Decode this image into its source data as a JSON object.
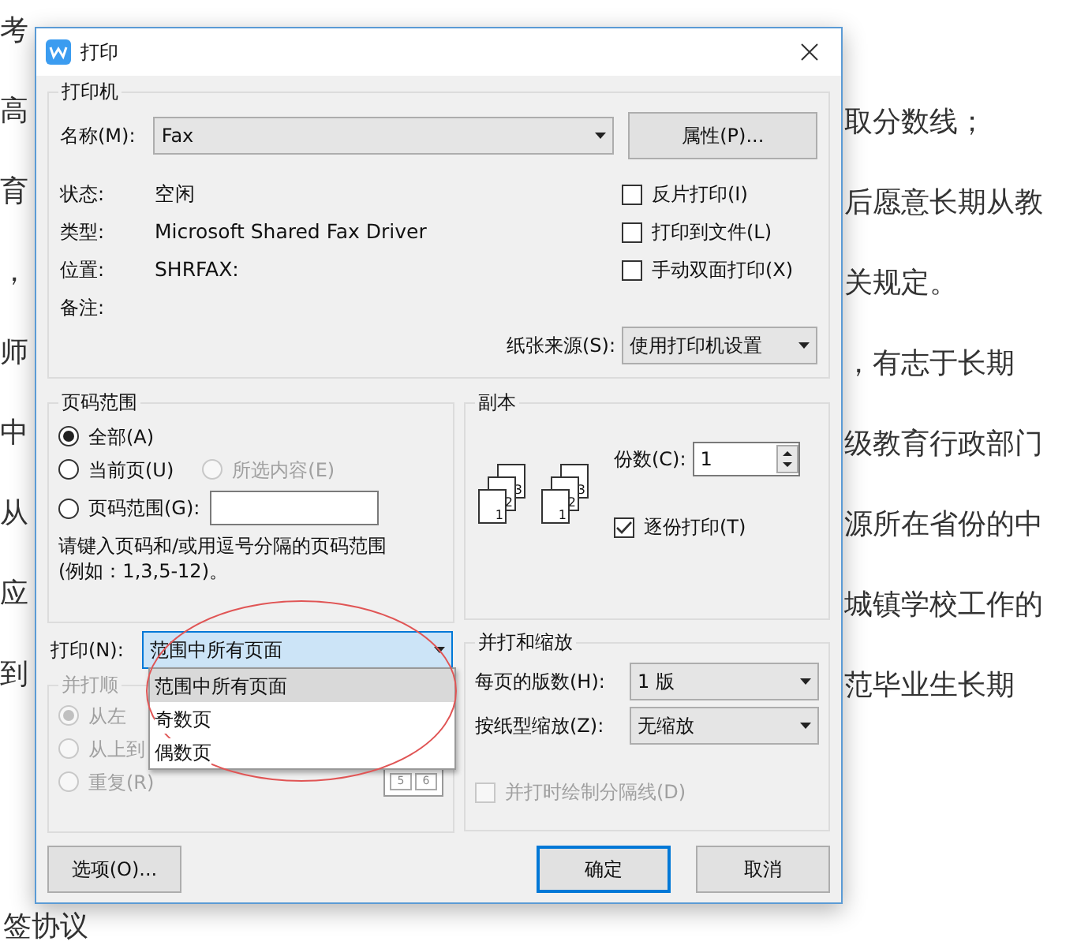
{
  "document": {
    "left_lines": [
      "考",
      "高",
      "育",
      "，",
      "师",
      "中",
      "从",
      "应",
      "到"
    ],
    "right_lines": [
      "取分数线；",
      "后愿意长期从教",
      "关规定。",
      "，有志于长期",
      "级教育行政部门",
      "源所在省份的中",
      "城镇学校工作的",
      "范毕业生长期"
    ],
    "bottom_line": "签协议"
  },
  "dialog": {
    "title": "打印",
    "printer": {
      "legend": "打印机",
      "name_label": "名称(M):",
      "name_value": "Fax",
      "properties_button": "属性(P)...",
      "info": [
        {
          "label": "状态:",
          "value": "空闲"
        },
        {
          "label": "类型:",
          "value": "Microsoft Shared Fax Driver"
        },
        {
          "label": "位置:",
          "value": "SHRFAX:"
        },
        {
          "label": "备注:"
        }
      ],
      "options": [
        {
          "label": "反片打印(I)",
          "checked": false
        },
        {
          "label": "打印到文件(L)",
          "checked": false
        },
        {
          "label": "手动双面打印(X)",
          "checked": false
        }
      ],
      "paper_source_label": "纸张来源(S):",
      "paper_source_value": "使用打印机设置"
    },
    "page_range": {
      "legend": "页码范围",
      "options": [
        {
          "label": "全部(A)",
          "selected": true,
          "disabled": false
        },
        {
          "label": "当前页(U)",
          "selected": false,
          "disabled": false
        },
        {
          "label": "所选内容(E)",
          "selected": false,
          "disabled": true
        },
        {
          "label": "页码范围(G):",
          "selected": false,
          "disabled": false
        }
      ],
      "hint_lines": [
        "请键入页码和/或用逗号分隔的页码范围",
        "(例如：1,3,5-12)。"
      ]
    },
    "copies": {
      "legend": "副本",
      "count_label": "份数(C):",
      "count_value": "1",
      "page_stacks": [
        [
          "1",
          "2",
          "3"
        ],
        [
          "1",
          "2",
          "3"
        ]
      ],
      "collate": {
        "label": "逐份打印(T)",
        "checked": true
      }
    },
    "print_what": {
      "label": "打印(N):",
      "value": "范围中所有页面",
      "menu": [
        {
          "label": "范围中所有页面",
          "selected": true
        },
        {
          "label": "奇数页",
          "selected": false
        },
        {
          "label": "偶数页",
          "selected": false
        }
      ]
    },
    "merge_order": {
      "legend": "并打顺",
      "disabled": true,
      "options": [
        {
          "label": "从左",
          "selected": true
        },
        {
          "label": "从上到",
          "selected": false
        },
        {
          "label": "重复(R)",
          "selected": false
        }
      ],
      "page_numbers": [
        "5",
        "6"
      ]
    },
    "zoom": {
      "legend": "并打和缩放",
      "pages_per_sheet_label": "每页的版数(H):",
      "pages_per_sheet_value": "1 版",
      "scale_label": "按纸型缩放(Z):",
      "scale_value": "无缩放",
      "draw_borders": {
        "label": "并打时绘制分隔线(D)",
        "checked": false,
        "disabled": true
      }
    },
    "buttons": [
      {
        "label": "选项(O)...",
        "kind": "secondary"
      },
      {
        "label": "确定",
        "kind": "default"
      },
      {
        "label": "取消",
        "kind": "secondary"
      }
    ]
  }
}
